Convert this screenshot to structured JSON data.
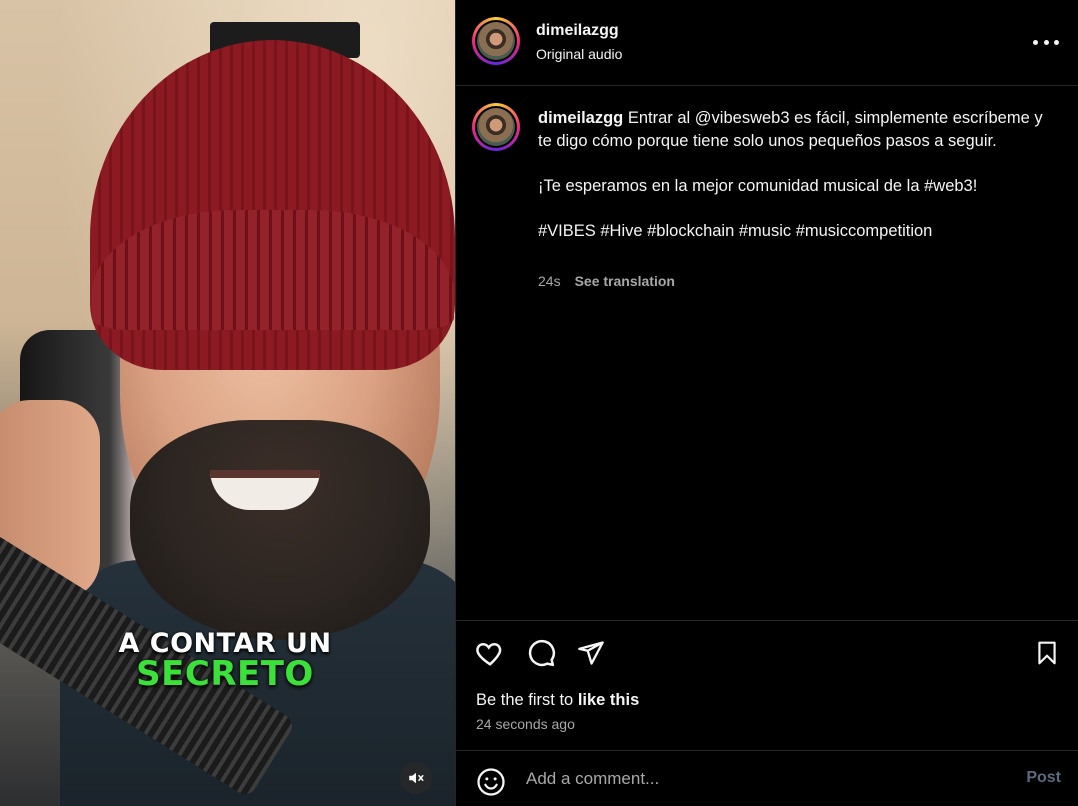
{
  "video": {
    "caption_line1": "A CONTAR UN",
    "caption_line2": "SECRETO",
    "caption_line2_color": "#3be03a",
    "mute_icon": "speaker-muted-icon"
  },
  "header": {
    "username": "dimeilazgg",
    "audio_label": "Original audio",
    "more_icon": "more-options-icon"
  },
  "post": {
    "username": "dimeilazgg",
    "caption_first": "Entrar al @vibesweb3 es fácil, simplemente escríbeme y te digo cómo porque tiene solo unos pequeños pasos a seguir.",
    "caption_second": "¡Te esperamos en la mejor comunidad musical de la #web3!",
    "hashtags": "#VIBES #Hive #blockchain #music #musiccompetition",
    "age": "24s",
    "see_translation": "See translation"
  },
  "actions": {
    "icons": [
      "heart-icon",
      "comment-icon",
      "share-icon",
      "bookmark-icon"
    ],
    "likes_prefix": "Be the first to",
    "likes_link": "like this",
    "timestamp": "24 seconds ago"
  },
  "comment": {
    "placeholder": "Add a comment...",
    "post_label": "Post",
    "post_color": "#5d6a7d"
  }
}
